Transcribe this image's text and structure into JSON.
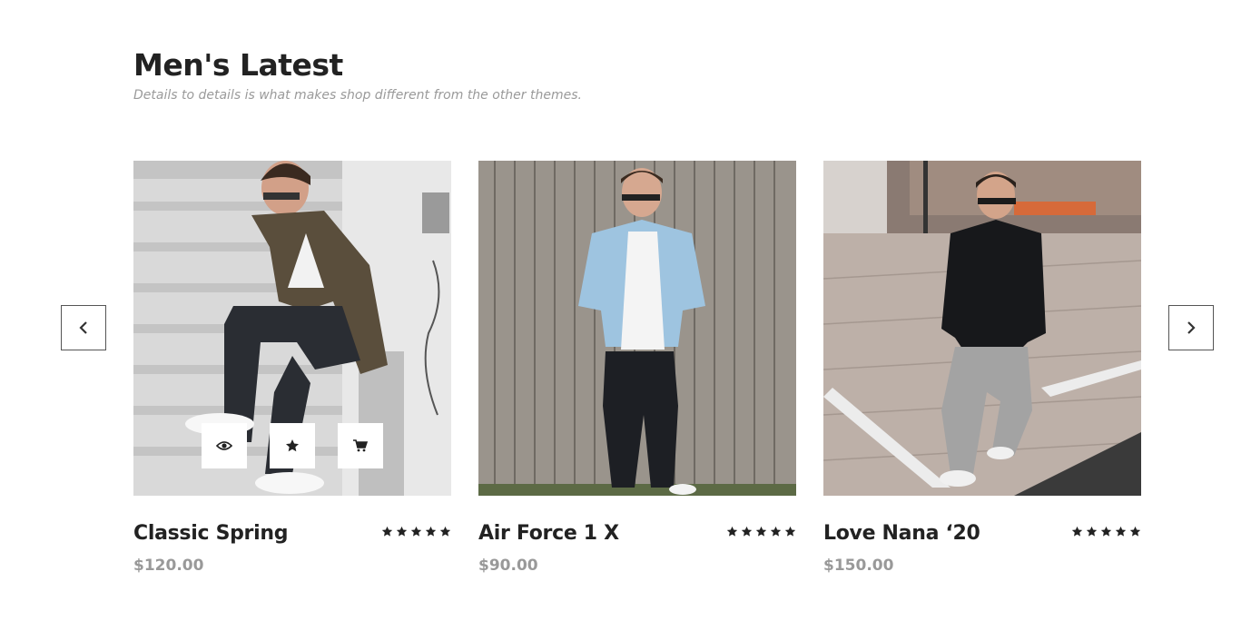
{
  "section": {
    "title": "Men's Latest",
    "subtitle": "Details to details is what makes shop different from the other themes."
  },
  "carousel": {
    "prev_icon": "chevron-left-icon",
    "next_icon": "chevron-right-icon"
  },
  "products": [
    {
      "name": "Classic Spring",
      "price": "$120.00",
      "rating": 5
    },
    {
      "name": "Air Force 1 X",
      "price": "$90.00",
      "rating": 5
    },
    {
      "name": "Love Nana ‘20",
      "price": "$150.00",
      "rating": 5
    }
  ],
  "hover_actions": [
    {
      "icon": "eye-icon"
    },
    {
      "icon": "star-icon"
    },
    {
      "icon": "cart-icon"
    }
  ],
  "colors": {
    "heading": "#222222",
    "subtitle": "#9a9a9a",
    "price": "#999999",
    "star": "#222222"
  }
}
